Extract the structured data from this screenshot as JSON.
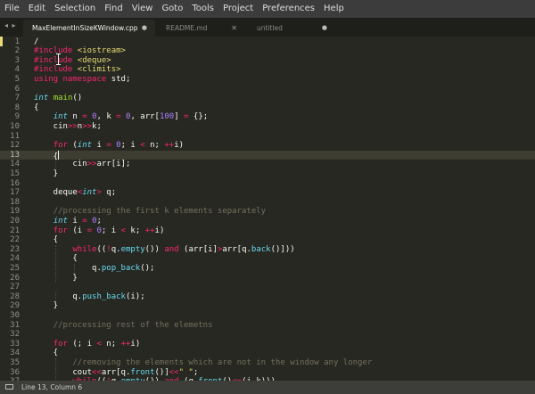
{
  "menu": [
    "File",
    "Edit",
    "Selection",
    "Find",
    "View",
    "Goto",
    "Tools",
    "Project",
    "Preferences",
    "Help"
  ],
  "tab_nav_icon": "left-right-arrows-icon",
  "tabs": [
    {
      "label": "MaxElementInSizeKWindow.cpp",
      "active": true,
      "indicator": "dirty-dot-icon"
    },
    {
      "label": "README.md",
      "active": false,
      "indicator": "close-icon"
    },
    {
      "label": "untitled",
      "active": false,
      "indicator": "dirty-dot-icon"
    }
  ],
  "editor": {
    "current_line": 13,
    "lines": [
      {
        "n": "1",
        "tokens": [
          [
            "plain",
            "/"
          ]
        ]
      },
      {
        "n": "2",
        "tokens": [
          [
            "pre",
            "#include "
          ],
          [
            "header",
            "<iostream>"
          ]
        ]
      },
      {
        "n": "3",
        "tokens": [
          [
            "pre",
            "#include "
          ],
          [
            "header",
            "<deque>"
          ]
        ]
      },
      {
        "n": "4",
        "tokens": [
          [
            "pre",
            "#include "
          ],
          [
            "header",
            "<climits>"
          ]
        ]
      },
      {
        "n": "5",
        "tokens": [
          [
            "keyword",
            "using namespace "
          ],
          [
            "plain",
            "std;"
          ]
        ]
      },
      {
        "n": "6",
        "tokens": []
      },
      {
        "n": "7",
        "tokens": [
          [
            "type",
            "int "
          ],
          [
            "func",
            "main"
          ],
          [
            "plain",
            "()"
          ]
        ]
      },
      {
        "n": "8",
        "tokens": [
          [
            "plain",
            "{"
          ]
        ]
      },
      {
        "n": "9",
        "tokens": [
          [
            "plain",
            "    "
          ],
          [
            "type",
            "int"
          ],
          [
            "plain",
            " n "
          ],
          [
            "keyword",
            "="
          ],
          [
            "plain",
            " "
          ],
          [
            "number",
            "0"
          ],
          [
            "plain",
            ", k "
          ],
          [
            "keyword",
            "="
          ],
          [
            "plain",
            " "
          ],
          [
            "number",
            "0"
          ],
          [
            "plain",
            ", arr["
          ],
          [
            "number",
            "100"
          ],
          [
            "plain",
            "] "
          ],
          [
            "keyword",
            "="
          ],
          [
            "plain",
            " {};"
          ]
        ]
      },
      {
        "n": "10",
        "tokens": [
          [
            "plain",
            "    cin"
          ],
          [
            "keyword",
            ">>"
          ],
          [
            "plain",
            "n"
          ],
          [
            "keyword",
            ">>"
          ],
          [
            "plain",
            "k;"
          ]
        ]
      },
      {
        "n": "11",
        "tokens": []
      },
      {
        "n": "12",
        "tokens": [
          [
            "plain",
            "    "
          ],
          [
            "keyword",
            "for"
          ],
          [
            "plain",
            " ("
          ],
          [
            "type",
            "int"
          ],
          [
            "plain",
            " i "
          ],
          [
            "keyword",
            "="
          ],
          [
            "plain",
            " "
          ],
          [
            "number",
            "0"
          ],
          [
            "plain",
            "; i "
          ],
          [
            "keyword",
            "<"
          ],
          [
            "plain",
            " n; "
          ],
          [
            "keyword",
            "++"
          ],
          [
            "plain",
            "i)"
          ]
        ]
      },
      {
        "n": "13",
        "tokens": [
          [
            "plain",
            "    {"
          ],
          [
            "caret",
            ""
          ]
        ]
      },
      {
        "n": "14",
        "tokens": [
          [
            "plain",
            "        cin"
          ],
          [
            "keyword",
            ">>"
          ],
          [
            "plain",
            "arr[i];"
          ]
        ]
      },
      {
        "n": "15",
        "tokens": [
          [
            "plain",
            "    }"
          ]
        ]
      },
      {
        "n": "16",
        "tokens": []
      },
      {
        "n": "17",
        "tokens": [
          [
            "plain",
            "    deque"
          ],
          [
            "keyword",
            "<"
          ],
          [
            "type",
            "int"
          ],
          [
            "keyword",
            ">"
          ],
          [
            "plain",
            " q;"
          ]
        ]
      },
      {
        "n": "18",
        "tokens": []
      },
      {
        "n": "19",
        "tokens": [
          [
            "plain",
            "    "
          ],
          [
            "comment",
            "//processing the first k elements separately"
          ]
        ]
      },
      {
        "n": "20",
        "tokens": [
          [
            "plain",
            "    "
          ],
          [
            "type",
            "int"
          ],
          [
            "plain",
            " i "
          ],
          [
            "keyword",
            "="
          ],
          [
            "plain",
            " "
          ],
          [
            "number",
            "0"
          ],
          [
            "plain",
            ";"
          ]
        ]
      },
      {
        "n": "21",
        "tokens": [
          [
            "plain",
            "    "
          ],
          [
            "keyword",
            "for"
          ],
          [
            "plain",
            " (i "
          ],
          [
            "keyword",
            "="
          ],
          [
            "plain",
            " "
          ],
          [
            "number",
            "0"
          ],
          [
            "plain",
            "; i "
          ],
          [
            "keyword",
            "<"
          ],
          [
            "plain",
            " k; "
          ],
          [
            "keyword",
            "++"
          ],
          [
            "plain",
            "i)"
          ]
        ]
      },
      {
        "n": "22",
        "tokens": [
          [
            "plain",
            "    {"
          ]
        ]
      },
      {
        "n": "23",
        "tokens": [
          [
            "plain",
            "        "
          ],
          [
            "keyword",
            "while"
          ],
          [
            "plain",
            "(("
          ],
          [
            "keyword",
            "!"
          ],
          [
            "plain",
            "q."
          ],
          [
            "method",
            "empty"
          ],
          [
            "plain",
            "()) "
          ],
          [
            "keyword",
            "and"
          ],
          [
            "plain",
            " (arr[i]"
          ],
          [
            "keyword",
            ">"
          ],
          [
            "plain",
            "arr[q."
          ],
          [
            "method",
            "back"
          ],
          [
            "plain",
            "()]))"
          ]
        ]
      },
      {
        "n": "24",
        "tokens": [
          [
            "plain",
            "        {"
          ]
        ]
      },
      {
        "n": "25",
        "tokens": [
          [
            "plain",
            "            q."
          ],
          [
            "method",
            "pop_back"
          ],
          [
            "plain",
            "();"
          ]
        ]
      },
      {
        "n": "26",
        "tokens": [
          [
            "plain",
            "        }"
          ]
        ]
      },
      {
        "n": "27",
        "tokens": []
      },
      {
        "n": "28",
        "tokens": [
          [
            "plain",
            "        q."
          ],
          [
            "method",
            "push_back"
          ],
          [
            "plain",
            "(i);"
          ]
        ]
      },
      {
        "n": "29",
        "tokens": [
          [
            "plain",
            "    }"
          ]
        ]
      },
      {
        "n": "30",
        "tokens": []
      },
      {
        "n": "31",
        "tokens": [
          [
            "plain",
            "    "
          ],
          [
            "comment",
            "//processing rest of the elemetns"
          ]
        ]
      },
      {
        "n": "32",
        "tokens": []
      },
      {
        "n": "33",
        "tokens": [
          [
            "plain",
            "    "
          ],
          [
            "keyword",
            "for"
          ],
          [
            "plain",
            " (; i "
          ],
          [
            "keyword",
            "<"
          ],
          [
            "plain",
            " n; "
          ],
          [
            "keyword",
            "++"
          ],
          [
            "plain",
            "i)"
          ]
        ]
      },
      {
        "n": "34",
        "tokens": [
          [
            "plain",
            "    {"
          ]
        ]
      },
      {
        "n": "35",
        "tokens": [
          [
            "plain",
            "        "
          ],
          [
            "comment",
            "//removing the elements which are not in the window any longer"
          ]
        ]
      },
      {
        "n": "36",
        "tokens": [
          [
            "plain",
            "        cout"
          ],
          [
            "keyword",
            "<<"
          ],
          [
            "plain",
            "arr[q."
          ],
          [
            "method",
            "front"
          ],
          [
            "plain",
            "()]"
          ],
          [
            "keyword",
            "<<"
          ],
          [
            "string",
            "\" \""
          ],
          [
            "plain",
            ";"
          ]
        ]
      },
      {
        "n": "37",
        "tokens": [
          [
            "plain",
            "        "
          ],
          [
            "keyword",
            "while"
          ],
          [
            "plain",
            "(("
          ],
          [
            "keyword",
            "!"
          ],
          [
            "plain",
            "q."
          ],
          [
            "method",
            "empty"
          ],
          [
            "plain",
            "()) "
          ],
          [
            "keyword",
            "and"
          ],
          [
            "plain",
            " (q."
          ],
          [
            "method",
            "front"
          ],
          [
            "plain",
            "()"
          ],
          [
            "keyword",
            "<="
          ],
          [
            "plain",
            "(i"
          ],
          [
            "keyword",
            "-"
          ],
          [
            "plain",
            "k)))"
          ]
        ]
      }
    ]
  },
  "status": {
    "icon": "panel-toggle-icon",
    "text": "Line 13, Column 6"
  },
  "colors": {
    "background": "#272822",
    "menubar": "#3c3c3c",
    "tabbar": "#1e1f1b",
    "statusbar": "#3d3d3a",
    "keyword": "#f92672",
    "type": "#66d9ef",
    "function": "#a6e22e",
    "number": "#ae81ff",
    "string": "#e6db74",
    "comment": "#75715e"
  }
}
